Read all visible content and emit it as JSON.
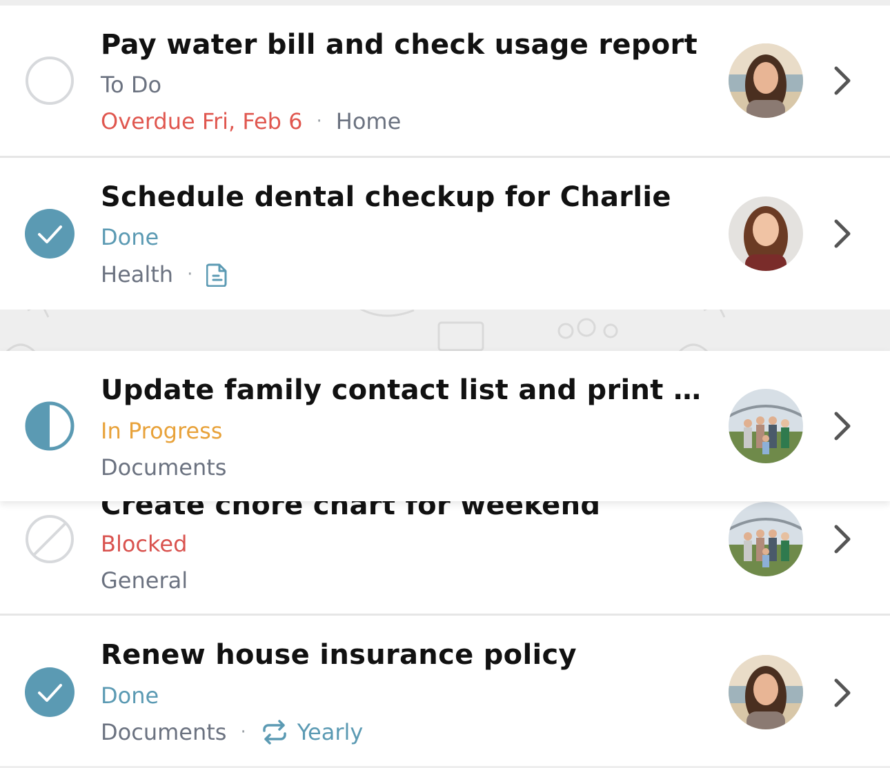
{
  "tasks": [
    {
      "title": "Pay water bill and check usage report",
      "status": "To Do",
      "due": "Overdue Fri, Feb 6",
      "category": "Home",
      "status_icon": "empty-circle-icon",
      "avatar": "woman-beach-avatar"
    },
    {
      "title": "Schedule dental checkup for Charlie",
      "status": "Done",
      "category": "Health",
      "status_icon": "check-circle-icon",
      "extra_icon": "document-icon",
      "avatar": "girl-avatar"
    },
    {
      "title": "Update family contact list and print c...",
      "status": "In Progress",
      "category": "Documents",
      "status_icon": "half-circle-icon",
      "avatar": "family-group-avatar"
    },
    {
      "title": "Create chore chart for weekend",
      "status": "Blocked",
      "category": "General",
      "status_icon": "blocked-circle-icon",
      "avatar": "family-group-avatar"
    },
    {
      "title": "Renew house insurance policy",
      "status": "Done",
      "category": "Documents",
      "repeat": "Yearly",
      "status_icon": "check-circle-icon",
      "extra_icon": "repeat-icon",
      "avatar": "woman-beach-avatar"
    }
  ],
  "separator": "·",
  "colors": {
    "done": "#5b9ab3",
    "overdue": "#e0574f",
    "in_progress": "#e8a23a",
    "blocked": "#d9534f",
    "muted": "#6b7280"
  }
}
